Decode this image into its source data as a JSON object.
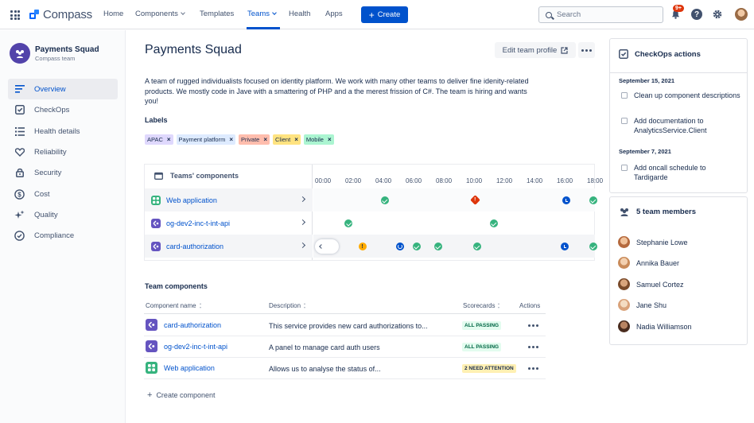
{
  "nav": {
    "brand": "Compass",
    "items": [
      {
        "label": "Home"
      },
      {
        "label": "Components"
      },
      {
        "label": "Templates"
      },
      {
        "label": "Teams"
      },
      {
        "label": "Health"
      },
      {
        "label": "Apps"
      }
    ],
    "create_label": "Create",
    "search_placeholder": "Search",
    "notification_badge": "9+"
  },
  "sidebar": {
    "team_name": "Payments Squad",
    "team_subtitle": "Compass team",
    "items": [
      {
        "label": "Overview",
        "icon": "overview-icon"
      },
      {
        "label": "CheckOps",
        "icon": "checkbox-icon"
      },
      {
        "label": "Health details",
        "icon": "list-icon"
      },
      {
        "label": "Reliability",
        "icon": "heart-icon"
      },
      {
        "label": "Security",
        "icon": "lock-icon"
      },
      {
        "label": "Cost",
        "icon": "dollar-icon"
      },
      {
        "label": "Quality",
        "icon": "sparkle-icon"
      },
      {
        "label": "Compliance",
        "icon": "check-circle-icon"
      }
    ]
  },
  "main": {
    "title": "Payments Squad",
    "edit_label": "Edit team profile",
    "description": "A team of rugged individualists focused on identity platform. We work with many other teams to deliver fine idenity-related products. We mostly code in Jave with a smattering of PHP and a the merest frission of C#. The team is hiring and wants you!",
    "labels_heading": "Labels",
    "labels": [
      {
        "text": "APAC",
        "bg": "#DFD8FD"
      },
      {
        "text": "Payment platform",
        "bg": "#DEEBFF"
      },
      {
        "text": "Private",
        "bg": "#FFBDAD"
      },
      {
        "text": "Client",
        "bg": "#FFE380"
      },
      {
        "text": "Mobile",
        "bg": "#ABF5D1"
      }
    ]
  },
  "timeline": {
    "heading": "Teams' components",
    "hours": [
      "00:00",
      "02:00",
      "04:00",
      "06:00",
      "08:00",
      "10:00",
      "12:00",
      "14:00",
      "16:00",
      "18:00"
    ],
    "rows": [
      {
        "name": "Web application",
        "icon": "web-app-icon",
        "events": [
          {
            "hour": 4.0,
            "status": "ok"
          },
          {
            "hour": 10.0,
            "status": "error"
          },
          {
            "hour": 16.0,
            "status": "pending"
          },
          {
            "hour": 17.8,
            "status": "ok"
          }
        ]
      },
      {
        "name": "og-dev2-inc-t-int-api",
        "icon": "api-icon",
        "events": [
          {
            "hour": 1.6,
            "status": "ok"
          },
          {
            "hour": 11.2,
            "status": "ok"
          }
        ]
      },
      {
        "name": "card-authorization",
        "icon": "api-icon",
        "events": [
          {
            "hour": 0.5,
            "status": "ok"
          },
          {
            "hour": 2.5,
            "status": "warning"
          },
          {
            "hour": 5.0,
            "status": "in-progress"
          },
          {
            "hour": 6.1,
            "status": "ok"
          },
          {
            "hour": 7.5,
            "status": "ok"
          },
          {
            "hour": 10.1,
            "status": "ok"
          },
          {
            "hour": 15.9,
            "status": "pending"
          },
          {
            "hour": 17.8,
            "status": "ok"
          }
        ]
      }
    ]
  },
  "team_components": {
    "title": "Team components",
    "headers": {
      "name": "Component name",
      "description": "Description",
      "scorecards": "Scorecards",
      "actions": "Actions"
    },
    "rows": [
      {
        "name": "card-authorization",
        "icon": "api-icon",
        "description": "This service provides new card authorizations to...",
        "score": "ALL PASSING",
        "score_type": "pass"
      },
      {
        "name": "og-dev2-inc-t-int-api",
        "icon": "api-icon",
        "description": "A panel to manage card auth users",
        "score": "ALL PASSING",
        "score_type": "pass"
      },
      {
        "name": "Web application",
        "icon": "web-app-icon",
        "description": "Allows us to analyse the status of...",
        "score": "2 NEED ATTENTION",
        "score_type": "attn"
      }
    ],
    "create_label": "Create component"
  },
  "checkops": {
    "title": "CheckOps actions",
    "groups": [
      {
        "date": "September 15, 2021",
        "items": [
          "Clean up component descriptions",
          "Add documentation to AnalyticsService.Client"
        ]
      },
      {
        "date": "September 7, 2021",
        "items": [
          "Add oncall schedule to Tardigarde"
        ]
      }
    ]
  },
  "members": {
    "title": "5 team members",
    "list": [
      {
        "name": "Stephanie Lowe",
        "color": "#B56A3E"
      },
      {
        "name": "Annika Bauer",
        "color": "#C98B5A"
      },
      {
        "name": "Samuel Cortez",
        "color": "#7A4A2A"
      },
      {
        "name": "Jane Shu",
        "color": "#D9A27A"
      },
      {
        "name": "Nadia Williamson",
        "color": "#4A2C1E"
      }
    ]
  }
}
